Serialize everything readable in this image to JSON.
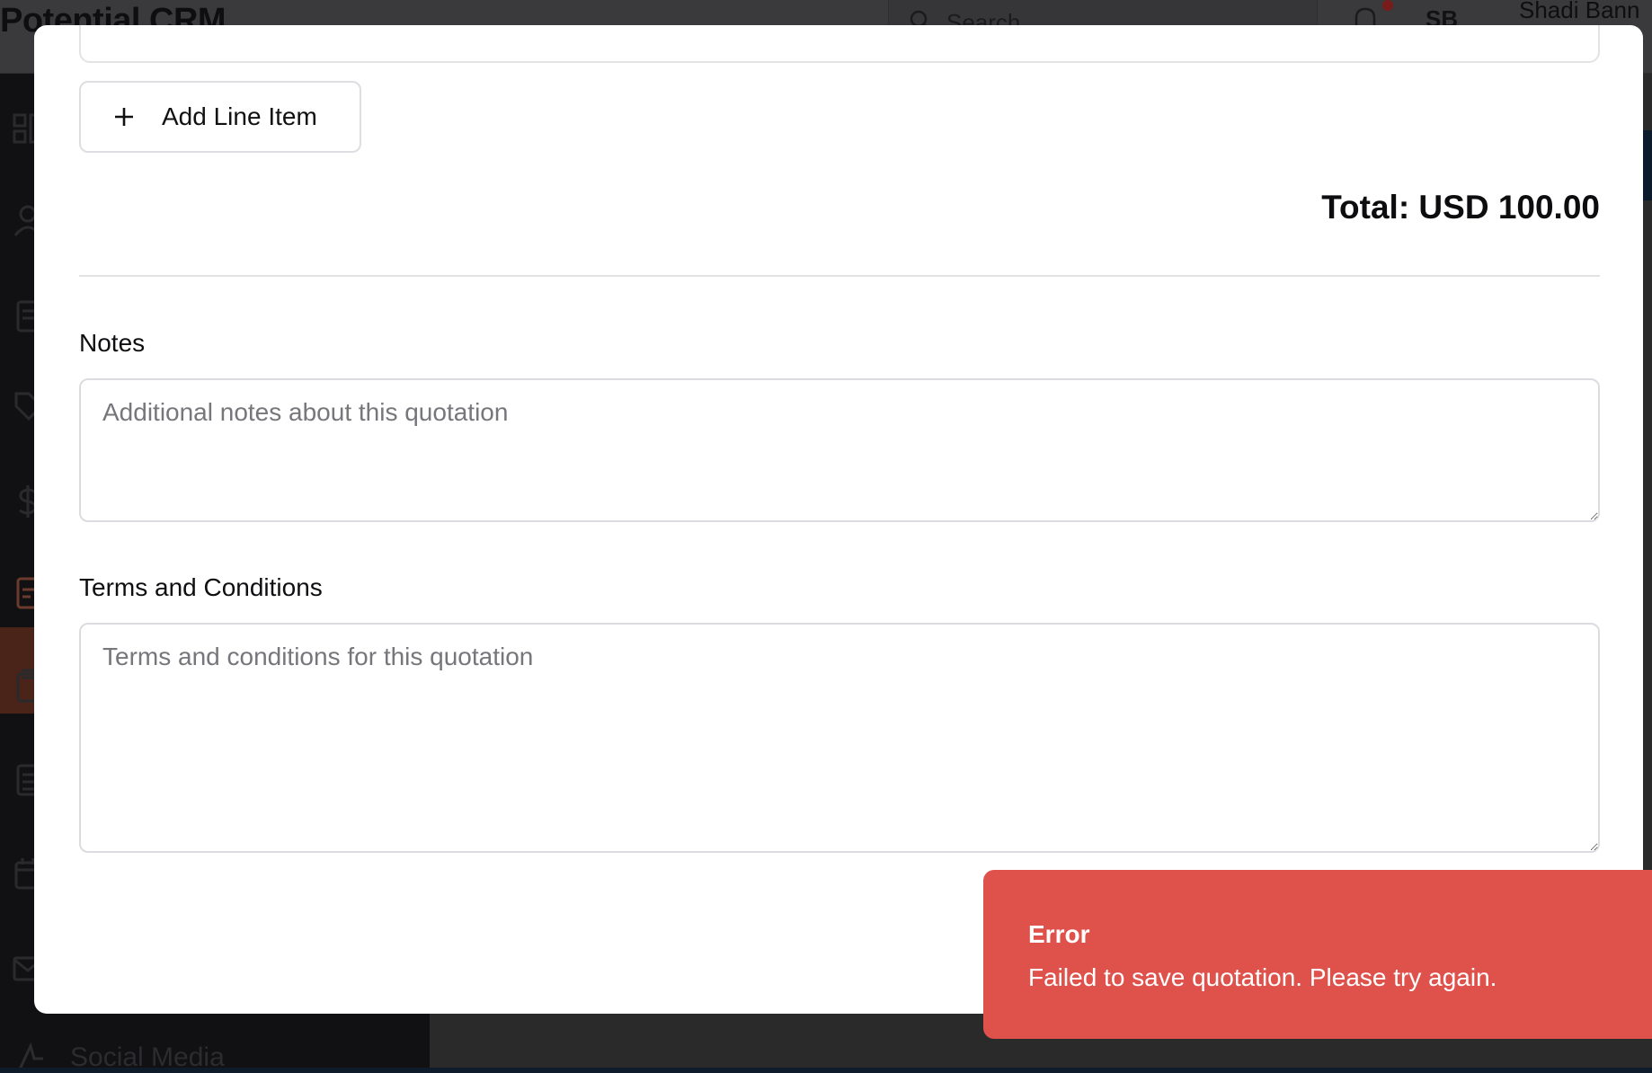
{
  "app": {
    "title": "Potential CRM",
    "search_placeholder": "Search",
    "avatar_initials": "SB",
    "user_name": "Shadi Bann",
    "sidebar_visible_label": "Social Media"
  },
  "modal": {
    "add_line_item_label": "Add Line Item",
    "total_text": "Total: USD 100.00",
    "notes": {
      "label": "Notes",
      "placeholder": "Additional notes about this quotation",
      "value": ""
    },
    "terms": {
      "label": "Terms and Conditions",
      "placeholder": "Terms and conditions for this quotation",
      "value": ""
    }
  },
  "toast": {
    "title": "Error",
    "message": "Failed to save quotation. Please try again.",
    "color": "#df524c"
  },
  "colors": {
    "overlay_dim": "#2a2a2b",
    "sidebar_active": "#4a2419"
  },
  "icons": [
    "search-icon",
    "bell-icon",
    "plus-icon",
    "dashboard-icon",
    "contacts-icon",
    "documents-icon",
    "tag-icon",
    "dollar-icon",
    "quotations-icon",
    "clipboard-icon",
    "list-icon",
    "calendar-icon",
    "mail-icon",
    "social-media-icon"
  ]
}
